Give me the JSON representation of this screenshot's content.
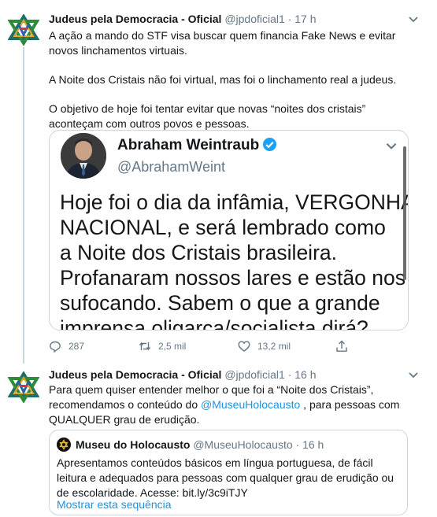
{
  "tweets": [
    {
      "author": "Judeus pela Democracia - Oficial",
      "handle": "@jpdoficial1",
      "time": "· 17 h",
      "paragraphs": [
        "A ação a mando do STF visa buscar quem financia Fake News e evitar novos linchamentos virtuais.",
        "A Noite dos Cristais não foi virtual, mas foi o linchamento real a judeus.",
        "O objetivo de hoje foi tentar evitar que novas “noites dos cristais” aconteçam com outros povos e pessoas."
      ],
      "media": {
        "name": "Abraham Weintraub",
        "handle": "@AbrahamWeint",
        "text_lines": [
          "Hoje foi o dia da infâmia, VERGONHA",
          "NACIONAL, e será lembrado como",
          "a Noite dos Cristais brasileira.",
          "Profanaram nossos lares e estão nos",
          "sufocando. Sabem o que a grande",
          "imprensa oligarca/socialista dirá?"
        ]
      },
      "actions": {
        "replies": "287",
        "retweets": "2,5 mil",
        "likes": "13,2 mil"
      }
    },
    {
      "author": "Judeus pela Democracia - Oficial",
      "handle": "@jpdoficial1",
      "time": "· 16 h",
      "text_before": "Para quem quiser entender melhor o que foi a “Noite dos Cristais”, recomendamos o conteúdo do ",
      "mention": "@MuseuHolocausto",
      "text_after": " , para pessoas com QUALQUER grau de erudição.",
      "quote": {
        "author": "Museu do Holocausto",
        "handle": "@MuseuHolocausto",
        "time": "· 16 h",
        "text": "Apresentamos conteúdos básicos em língua portuguesa, de fácil leitura e adequados para pessoas com qualquer grau de erudição ou de escolaridade. Acesse: bit.ly/3c9iTJY",
        "show_thread": "Mostrar esta sequência"
      }
    }
  ],
  "colors": {
    "link": "#1b95e0",
    "secondary": "#657786",
    "border": "#ccd6dd",
    "text": "#14171a"
  },
  "icons": [
    "star-of-david-icon",
    "chevron-down-icon",
    "verified-badge-icon",
    "reply-icon",
    "retweet-icon",
    "like-icon",
    "share-icon"
  ]
}
